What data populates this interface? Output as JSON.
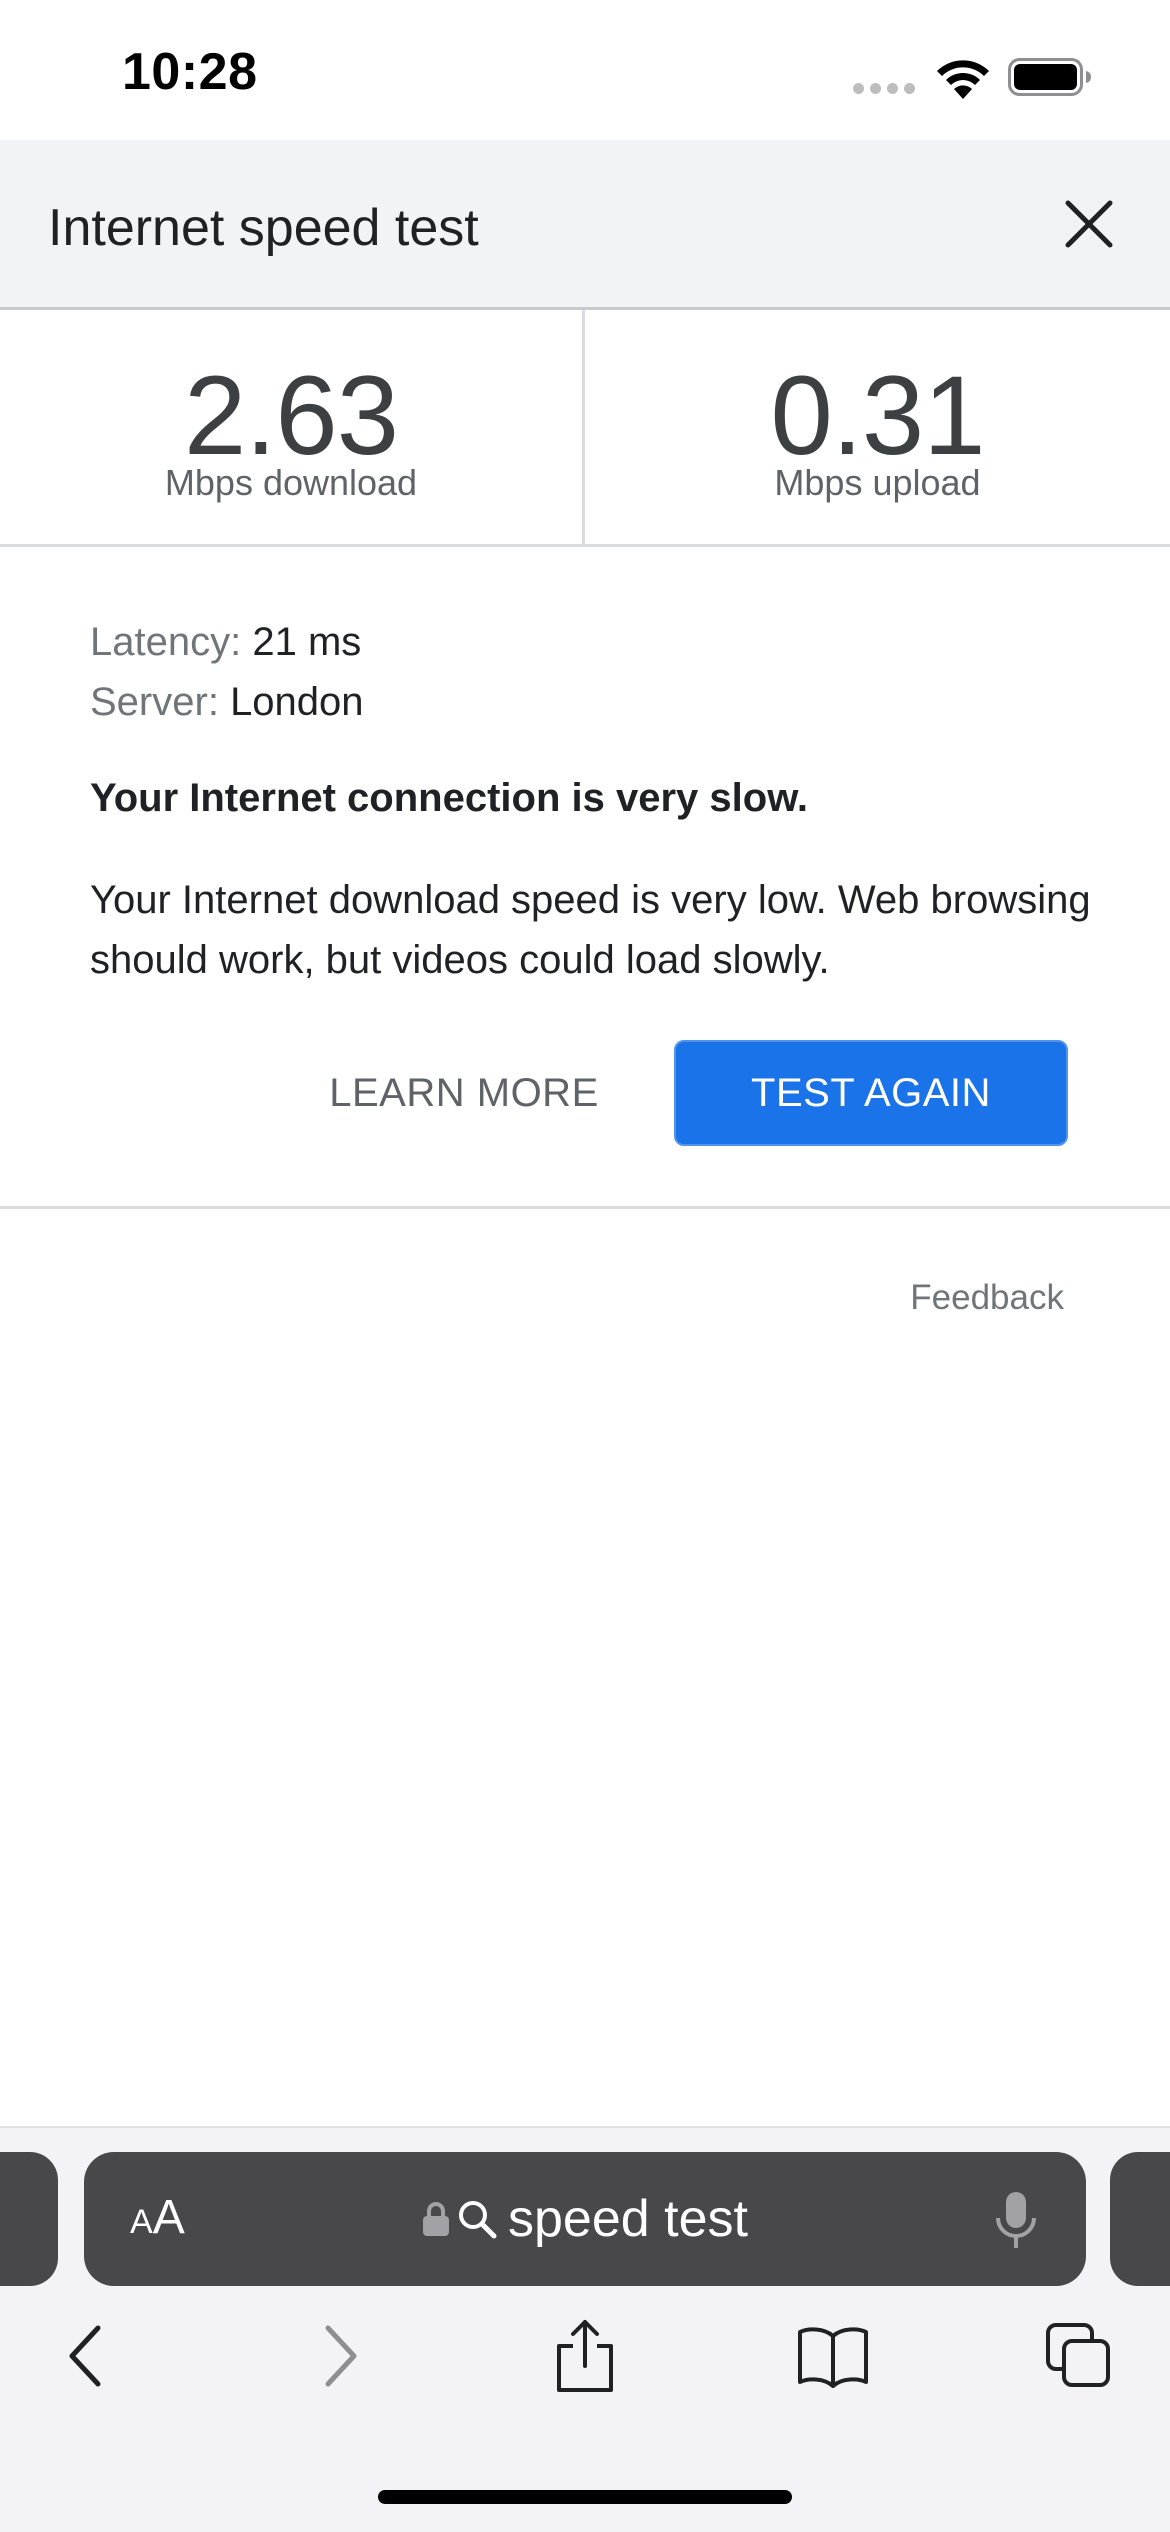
{
  "status_bar": {
    "time": "10:28"
  },
  "header": {
    "title": "Internet speed test"
  },
  "results": {
    "download_value": "2.63",
    "download_label": "Mbps download",
    "upload_value": "0.31",
    "upload_label": "Mbps upload"
  },
  "details": {
    "latency_key": "Latency:",
    "latency_value": "21 ms",
    "server_key": "Server:",
    "server_value": "London",
    "verdict": "Your Internet connection is very slow.",
    "description": "Your Internet download speed is very low. Web browsing should work, but videos could load slowly."
  },
  "actions": {
    "learn_more": "LEARN MORE",
    "test_again": "TEST AGAIN"
  },
  "feedback": "Feedback",
  "browser": {
    "aa_small": "A",
    "aa_big": "A",
    "address_text": "speed test"
  },
  "colors": {
    "accent": "#1a73e8",
    "header_bg": "#f1f3f4",
    "address_bar_bg": "#48484a"
  },
  "icons": {
    "close": "close-icon",
    "wifi": "wifi-icon",
    "battery": "battery-icon",
    "lock": "lock-icon",
    "search": "search-icon",
    "mic": "microphone-icon",
    "back": "chevron-left-icon",
    "forward": "chevron-right-icon",
    "share": "share-icon",
    "bookmarks": "book-icon",
    "tabs": "tabs-icon"
  }
}
